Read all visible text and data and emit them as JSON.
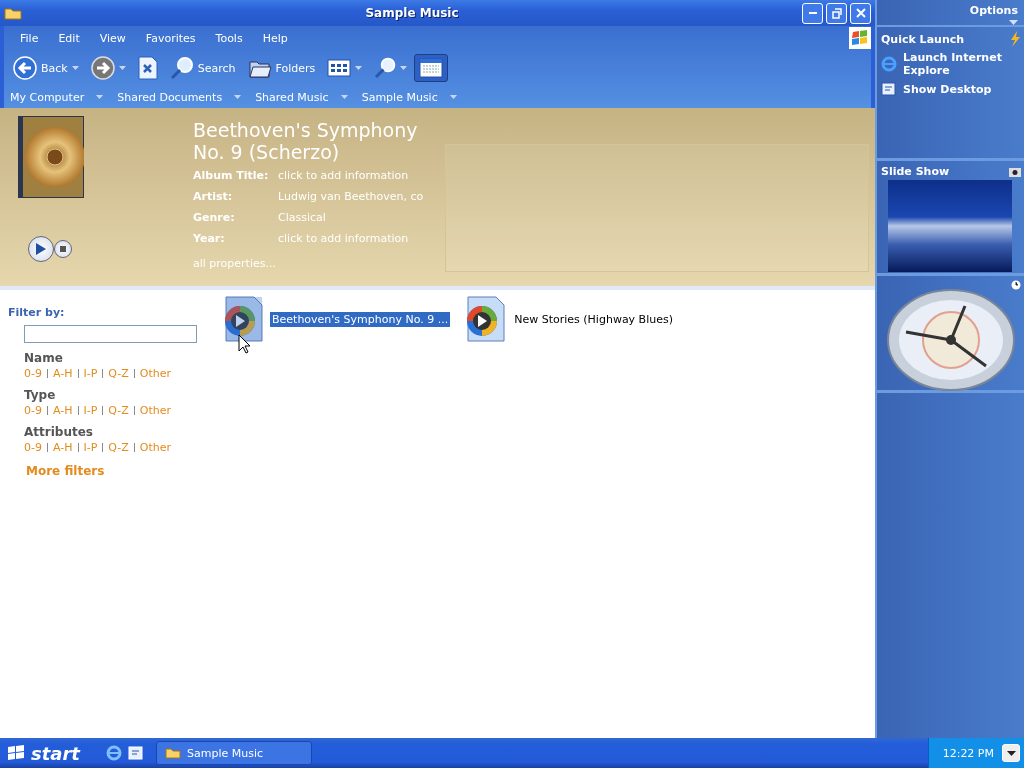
{
  "window": {
    "title": "Sample Music"
  },
  "menu": [
    "File",
    "Edit",
    "View",
    "Favorites",
    "Tools",
    "Help"
  ],
  "toolbar": [
    {
      "kind": "back",
      "label": "Back"
    },
    {
      "kind": "forward"
    },
    {
      "kind": "up"
    },
    {
      "kind": "search",
      "label": "Search"
    },
    {
      "kind": "folders",
      "label": "Folders"
    },
    {
      "kind": "views"
    },
    {
      "kind": "zoom"
    },
    {
      "kind": "panel",
      "selected": true
    }
  ],
  "breadcrumb": [
    "My Computer",
    "Shared Documents",
    "Shared Music",
    "Sample Music"
  ],
  "details": {
    "title": "Beethoven's Symphony No. 9 (Scherzo)",
    "fields": [
      {
        "label": "Album Title:",
        "value": "click to add information"
      },
      {
        "label": "Artist:",
        "value": "Ludwig van Beethoven, co"
      },
      {
        "label": "Genre:",
        "value": "Classical"
      },
      {
        "label": "Year:",
        "value": "click to add information"
      }
    ],
    "link": "all properties..."
  },
  "filter": {
    "heading": "Filter by:",
    "groups": [
      {
        "name": "Name",
        "options": [
          "0-9",
          "A-H",
          "I-P",
          "Q-Z",
          "Other"
        ]
      },
      {
        "name": "Type",
        "options": [
          "0-9",
          "A-H",
          "I-P",
          "Q-Z",
          "Other"
        ]
      },
      {
        "name": "Attributes",
        "options": [
          "0-9",
          "A-H",
          "I-P",
          "Q-Z",
          "Other"
        ]
      }
    ],
    "more": "More filters"
  },
  "files": [
    {
      "name": "Beethoven's Symphony No. 9 ...",
      "selected": true
    },
    {
      "name": "New Stories (Highway Blues)",
      "selected": false
    }
  ],
  "sidebar": {
    "options": "Options",
    "quick_launch": {
      "title": "Quick Launch",
      "items": [
        {
          "kind": "ie",
          "label": "Launch Internet Explore"
        },
        {
          "kind": "desktop",
          "label": "Show Desktop"
        }
      ]
    },
    "slide_show": {
      "title": "Slide Show"
    }
  },
  "taskbar": {
    "start": "start",
    "tasks": [
      "Sample Music"
    ],
    "clock": "12:22 PM"
  }
}
